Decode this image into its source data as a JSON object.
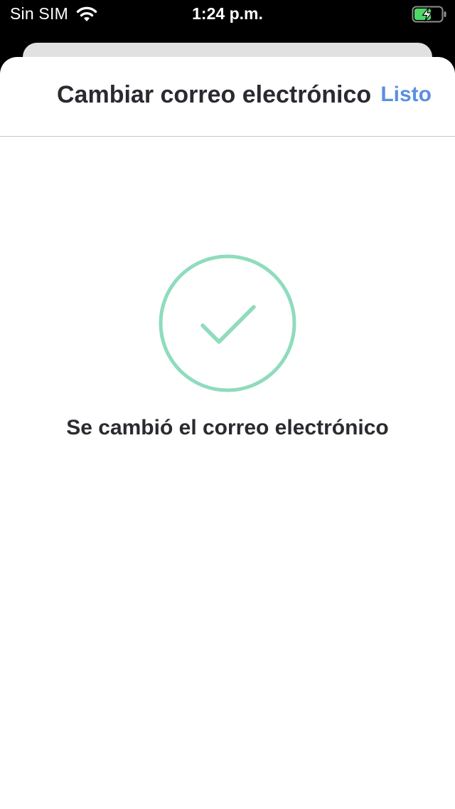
{
  "status_bar": {
    "carrier": "Sin SIM",
    "time": "1:24 p.m.",
    "wifi_icon": "wifi-icon",
    "battery_icon": "battery-charging-icon"
  },
  "header": {
    "title": "Cambiar correo electrónico",
    "done_label": "Listo"
  },
  "main": {
    "success_icon": "checkmark-circle-icon",
    "message": "Se cambió el correo electrónico"
  },
  "colors": {
    "accent": "#5b8fe0",
    "success": "#8fdcbd",
    "battery_fill": "#4cd964",
    "title_text": "#2a2b30"
  }
}
